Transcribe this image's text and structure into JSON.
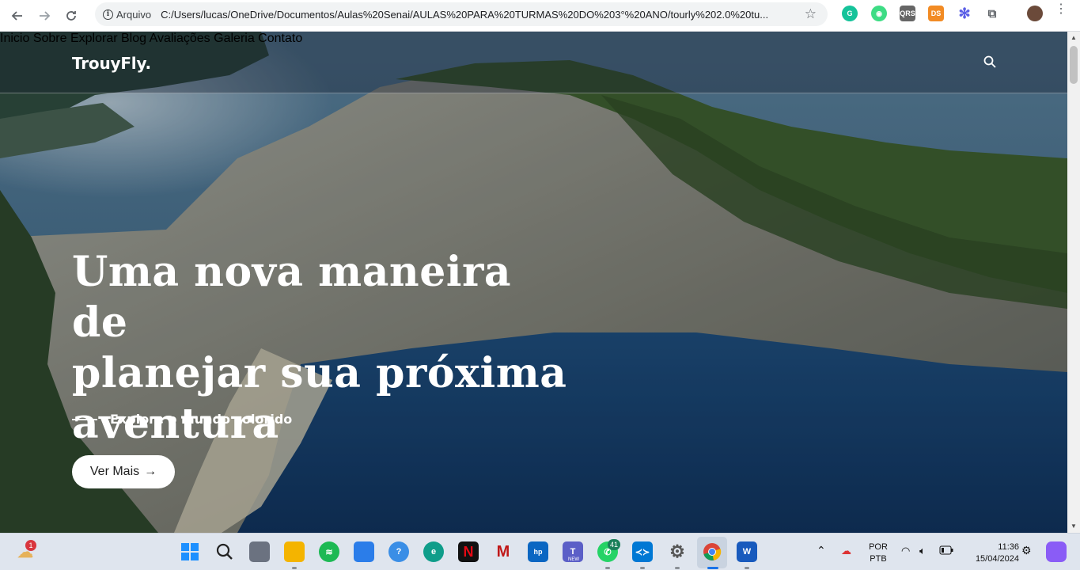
{
  "browser": {
    "site_chip": "Arquivo",
    "url": "C:/Users/lucas/OneDrive/Documentos/Aulas%20Senai/AULAS%20PARA%20TURMAS%20DO%203°%20ANO/tourly%202.0%20tu...",
    "extensions": [
      "grammarly-icon",
      "android-icon",
      "qrs-icon",
      "ds-icon",
      "gear-flower-icon",
      "puzzle-icon",
      "profile-avatar"
    ],
    "ext_labels": {
      "qrs": "QRS",
      "ds": "DS"
    }
  },
  "site": {
    "brand": "TrouyFly.",
    "menu": [
      "Inicio",
      "Sobre",
      "Explorar",
      "Blog",
      "Avaliações",
      "Galeria",
      "Contato"
    ],
    "headline": [
      "Uma nova maneira de",
      "planejar sua próxima",
      "aventura"
    ],
    "subtitle": "Explore o mundo colorido",
    "cta": "Ver Mais",
    "cta_arrow": "→"
  },
  "taskbar": {
    "weather_badge": "1",
    "whatsapp_badge": "41",
    "teams_label": "NEW",
    "lang_top": "POR",
    "lang_bottom": "PTB",
    "time": "11:36",
    "date": "15/04/2024"
  }
}
